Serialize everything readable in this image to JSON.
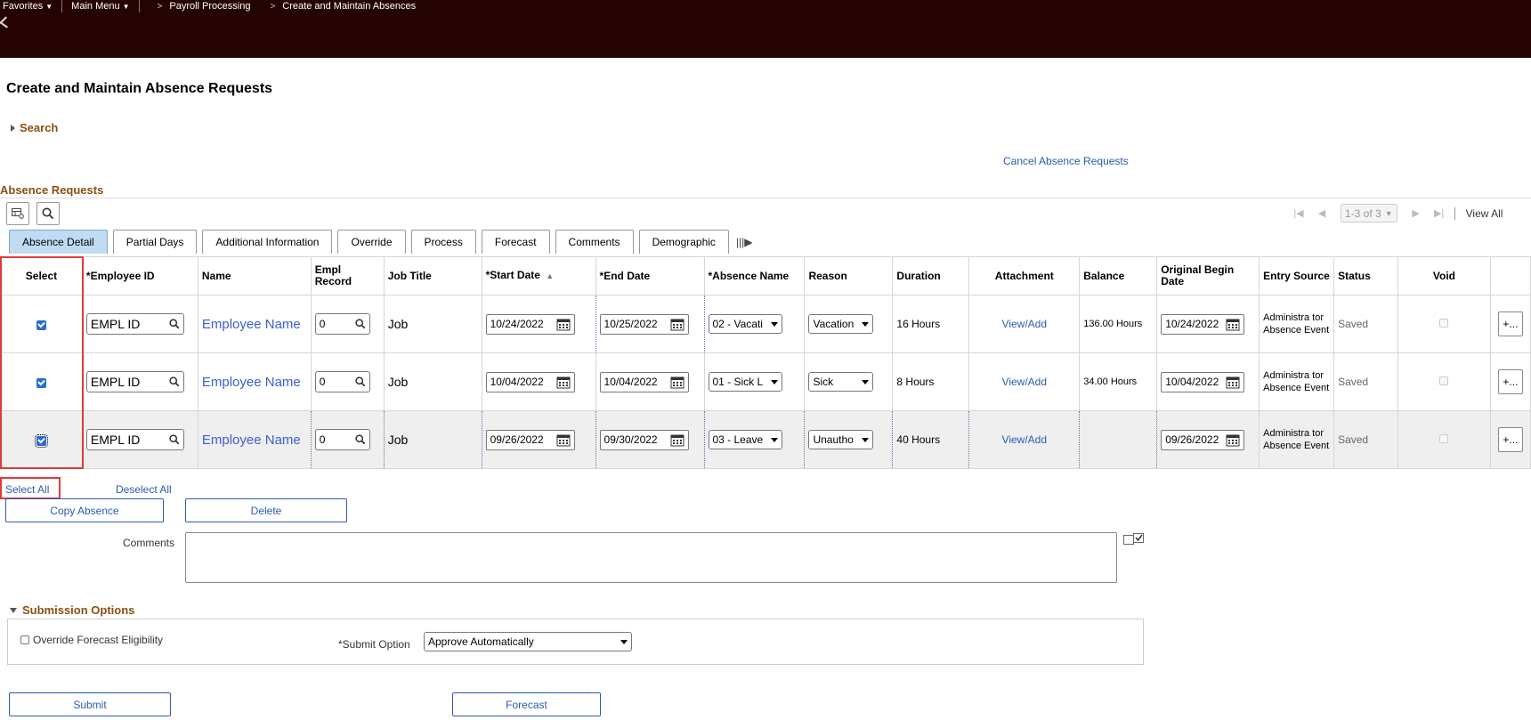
{
  "nav": {
    "favorites": "Favorites",
    "main_menu": "Main Menu",
    "crumb_1": "Payroll Processing",
    "crumb_2": "Create and Maintain Absences"
  },
  "page": {
    "title": "Create and Maintain Absence Requests",
    "search": "Search",
    "cancel_link": "Cancel Absence Requests",
    "section_title": "Absence Requests"
  },
  "pager": {
    "range": "1-3 of 3",
    "view_all": "View All"
  },
  "tabs": [
    {
      "label": "Absence Detail",
      "active": true
    },
    {
      "label": "Partial Days"
    },
    {
      "label": "Additional Information"
    },
    {
      "label": "Override"
    },
    {
      "label": "Process"
    },
    {
      "label": "Forecast"
    },
    {
      "label": "Comments"
    },
    {
      "label": "Demographic"
    }
  ],
  "columns": {
    "select": "Select",
    "employee_id": "*Employee ID",
    "name": "Name",
    "empl_record": "Empl Record",
    "job_title": "Job Title",
    "start_date": "*Start Date",
    "end_date": "*End Date",
    "absence_name": "*Absence Name",
    "reason": "Reason",
    "duration": "Duration",
    "attachment": "Attachment",
    "balance": "Balance",
    "original_begin": "Original Begin Date",
    "entry_source": "Entry Source",
    "status": "Status",
    "void": "Void"
  },
  "rows": [
    {
      "employee_id": "EMPL ID",
      "name": "Employee Name",
      "empl_record": "0",
      "job_title": "Job",
      "start_date": "10/24/2022",
      "end_date": "10/25/2022",
      "absence_name": "02 - Vacati",
      "reason": "Vacation",
      "duration": "16 Hours",
      "attachment": "View/Add",
      "balance": "136.00 Hours",
      "original_begin": "10/24/2022",
      "entry_source": "Administra tor Absence Event",
      "status": "Saved",
      "add": "+..."
    },
    {
      "employee_id": "EMPL ID",
      "name": "Employee Name",
      "empl_record": "0",
      "job_title": "Job",
      "start_date": "10/04/2022",
      "end_date": "10/04/2022",
      "absence_name": "01 - Sick L",
      "reason": "Sick",
      "duration": "8 Hours",
      "attachment": "View/Add",
      "balance": "34.00 Hours",
      "original_begin": "10/04/2022",
      "entry_source": "Administra tor Absence Event",
      "status": "Saved",
      "add": "+..."
    },
    {
      "employee_id": "EMPL ID",
      "name": "Employee Name",
      "empl_record": "0",
      "job_title": "Job",
      "start_date": "09/26/2022",
      "end_date": "09/30/2022",
      "absence_name": "03 - Leave",
      "reason": "Unautho",
      "duration": "40 Hours",
      "attachment": "View/Add",
      "balance": "",
      "original_begin": "09/26/2022",
      "entry_source": "Administra tor Absence Event",
      "status": "Saved",
      "add": "+..."
    }
  ],
  "actions": {
    "select_all": "Select All",
    "deselect_all": "Deselect All",
    "copy_absence": "Copy Absence",
    "delete": "Delete",
    "comments_label": "Comments"
  },
  "submission": {
    "title": "Submission Options",
    "override_label": "Override Forecast Eligibility",
    "submit_option_label": "*Submit Option",
    "submit_option_value": "Approve Automatically",
    "submit": "Submit",
    "forecast": "Forecast"
  },
  "colors": {
    "topbar": "#260303",
    "link": "#2b5dad",
    "section": "#8a4f12",
    "highlight": "#e03b3b",
    "active_tab": "#bfdcf3"
  }
}
